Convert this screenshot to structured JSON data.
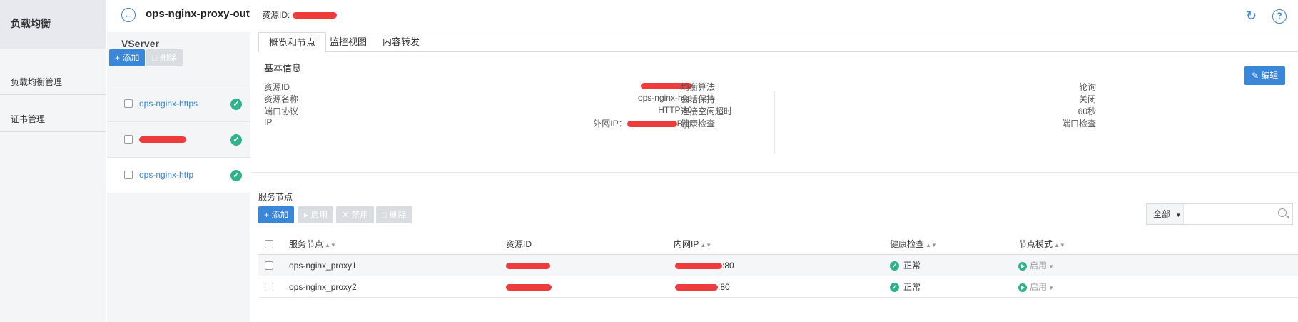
{
  "nav": {
    "title": "负载均衡",
    "items": [
      "负载均衡管理",
      "证书管理"
    ]
  },
  "header": {
    "title": "ops-nginx-proxy-out",
    "resource_id_label": "资源ID:",
    "back_icon": "arrow-left-icon",
    "refresh_icon": "refresh-icon",
    "help_icon": "help-icon"
  },
  "vserver": {
    "title": "VServer",
    "add_label": "+ 添加",
    "delete_label": "删除",
    "items": [
      {
        "name": "ops-nginx-https",
        "status": "ok"
      },
      {
        "name": "",
        "status": "ok"
      },
      {
        "name": "ops-nginx-http",
        "status": "ok"
      }
    ]
  },
  "tabs": [
    "概览和节点",
    "监控视图",
    "内容转发"
  ],
  "basic_info": {
    "title": "基本信息",
    "edit_label": "编辑",
    "left": [
      {
        "label": "资源ID",
        "value": ""
      },
      {
        "label": "资源名称",
        "value": "ops-nginx-http"
      },
      {
        "label": "端口协议",
        "value": "HTTP 80"
      },
      {
        "label": "IP",
        "value_prefix": "外网IP：",
        "value_suffix": "Bgp"
      }
    ],
    "right": [
      {
        "label": "均衡算法",
        "value": "轮询"
      },
      {
        "label": "会话保持",
        "value": "关闭"
      },
      {
        "label": "连接空闲超时",
        "value": "60秒"
      },
      {
        "label": "健康检查",
        "value": "端口检查"
      }
    ]
  },
  "nodes": {
    "title": "服务节点",
    "buttons": {
      "add": "+ 添加",
      "enable": "启用",
      "disable": "禁用",
      "delete": "删除"
    },
    "filter": {
      "selected": "全部"
    },
    "columns": [
      "服务节点",
      "资源ID",
      "内网IP",
      "健康检查",
      "节点模式"
    ],
    "rows": [
      {
        "name": "ops-nginx_proxy1",
        "port_suffix": ":80",
        "health": "正常",
        "mode": "启用"
      },
      {
        "name": "ops-nginx_proxy2",
        "port_suffix": ":80",
        "health": "正常",
        "mode": "启用"
      }
    ]
  },
  "colors": {
    "accent": "#3a86d8",
    "ok": "#2fb38a",
    "redact": "#ee3b3b"
  }
}
